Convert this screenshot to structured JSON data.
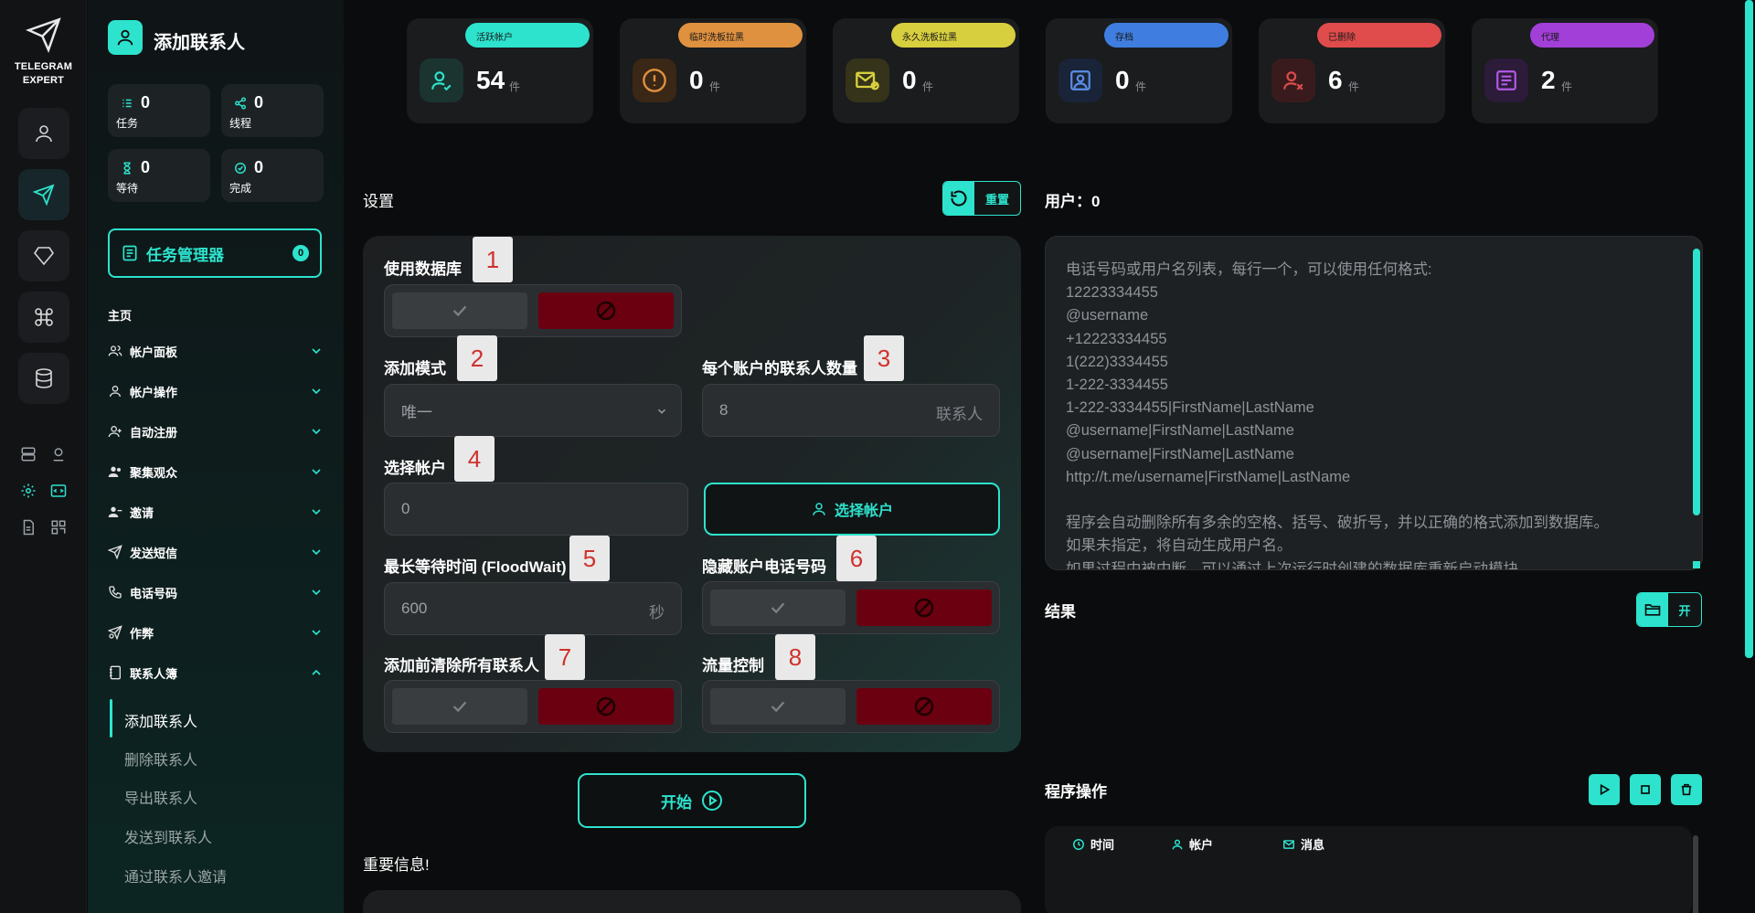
{
  "app": {
    "logo_line1": "TELEGRAM",
    "logo_line2": "EXPERT"
  },
  "sidebar": {
    "title": "添加联系人",
    "stats": [
      {
        "value": "0",
        "label": "任务",
        "icon": "list-icon"
      },
      {
        "value": "0",
        "label": "线程",
        "icon": "share-icon"
      },
      {
        "value": "0",
        "label": "等待",
        "icon": "hourglass-icon"
      },
      {
        "value": "0",
        "label": "完成",
        "icon": "check-circle-icon"
      }
    ],
    "task_manager": {
      "label": "任务管理器",
      "badge": "0"
    },
    "section_label": "主页",
    "nav": [
      {
        "label": "帐户面板",
        "icon": "users-icon"
      },
      {
        "label": "帐户操作",
        "icon": "user-icon"
      },
      {
        "label": "自动注册",
        "icon": "user-plus-icon"
      },
      {
        "label": "聚集观众",
        "icon": "group-icon"
      },
      {
        "label": "邀请",
        "icon": "invite-icon"
      },
      {
        "label": "发送短信",
        "icon": "send-icon"
      },
      {
        "label": "电话号码",
        "icon": "phone-icon"
      },
      {
        "label": "作弊",
        "icon": "cheat-icon"
      },
      {
        "label": "联系人簿",
        "icon": "book-icon"
      }
    ],
    "sub_items": [
      "添加联系人",
      "删除联系人",
      "导出联系人",
      "发送到联系人",
      "通过联系人邀请"
    ]
  },
  "cards": [
    {
      "chip": "活跃帐户",
      "value": "54",
      "unit": "件",
      "color": "#2de3cd",
      "icon": "user-check-icon"
    },
    {
      "chip": "临时洗板拉黑",
      "value": "0",
      "unit": "件",
      "color": "#e0913f",
      "icon": "alert-circle-icon"
    },
    {
      "chip": "永久洗板拉黑",
      "value": "0",
      "unit": "件",
      "color": "#d8cf3f",
      "icon": "mail-blocked-icon"
    },
    {
      "chip": "存档",
      "value": "0",
      "unit": "件",
      "color": "#3f7ee0",
      "icon": "archive-icon"
    },
    {
      "chip": "已删除",
      "value": "6",
      "unit": "件",
      "color": "#e04b4b",
      "icon": "user-x-icon"
    },
    {
      "chip": "代理",
      "value": "2",
      "unit": "件",
      "color": "#a23fd8",
      "icon": "proxy-icon"
    }
  ],
  "settings": {
    "title": "设置",
    "reset_label": "重置",
    "use_db": {
      "label": "使用数据库",
      "tag": "1"
    },
    "add_mode": {
      "label": "添加模式",
      "tag": "2",
      "value": "唯一"
    },
    "per_account": {
      "label": "每个账户的联系人数量",
      "tag": "3",
      "placeholder": "8",
      "suffix": "联系人"
    },
    "select_account": {
      "label": "选择帐户",
      "tag": "4",
      "value": "0",
      "button": "选择帐户"
    },
    "flood_wait": {
      "label": "最长等待时间 (FloodWait)",
      "tag": "5",
      "placeholder": "600",
      "suffix": "秒"
    },
    "hide_phone": {
      "label": "隐藏账户电话号码",
      "tag": "6"
    },
    "clear_before": {
      "label": "添加前清除所有联系人",
      "tag": "7"
    },
    "traffic": {
      "label": "流量控制",
      "tag": "8"
    },
    "start_label": "开始",
    "important": "重要信息!"
  },
  "users": {
    "title": "用户：0",
    "placeholder": "电话号码或用户名列表，每行一个，可以使用任何格式:\n12223334455\n@username\n+12223334455\n1(222)3334455\n1-222-3334455\n1-222-3334455|FirstName|LastName\n@username|FirstName|LastName\n@username|FirstName|LastName\nhttp://t.me/username|FirstName|LastName\n\n程序会自动删除所有多余的空格、括号、破折号，并以正确的格式添加到数据库。\n如果未指定，将自动生成用户名。\n如果过程中被中断，可以通过上次运行时创建的数据库重新启动模块。"
  },
  "results": {
    "title": "结果",
    "open_label": "开"
  },
  "ops": {
    "title": "程序操作",
    "columns": [
      "时间",
      "帐户",
      "消息"
    ]
  },
  "colors": {
    "accent": "#2de3cd",
    "danger": "#6b0010"
  }
}
